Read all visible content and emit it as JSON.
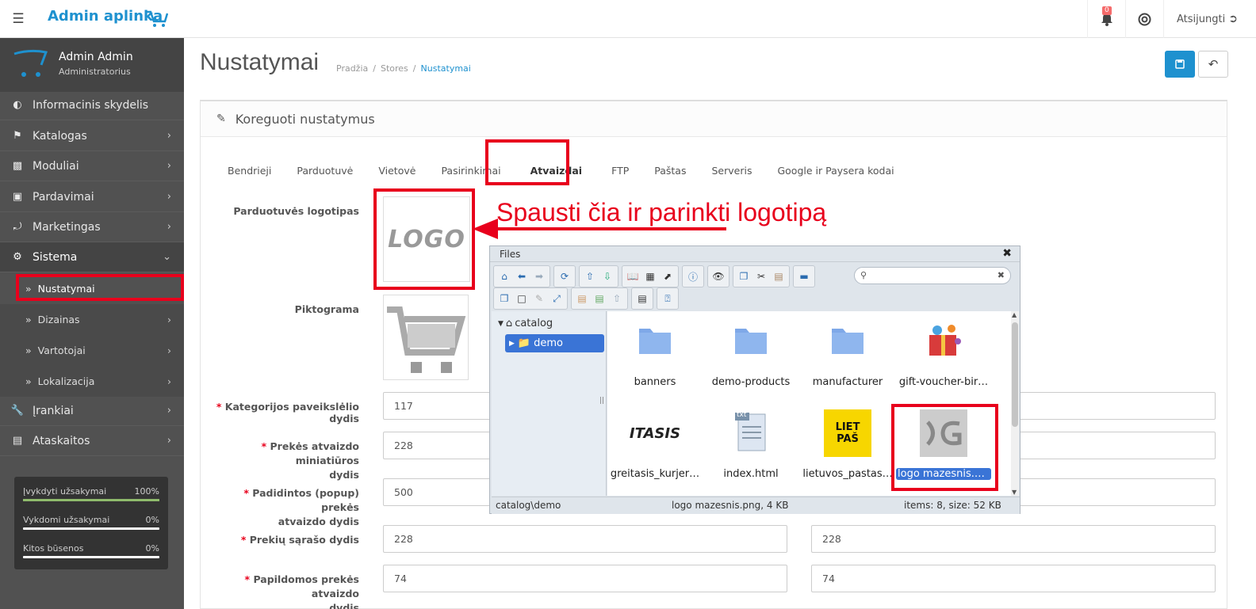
{
  "topbar": {
    "brand": "Admin aplinka",
    "notif_count": "0",
    "logout": "Atsijungti"
  },
  "profile": {
    "name": "Admin Admin",
    "role": "Administratorius"
  },
  "nav": {
    "dashboard": "Informacinis skydelis",
    "catalog": "Katalogas",
    "modules": "Moduliai",
    "sales": "Pardavimai",
    "marketing": "Marketingas",
    "system": "Sistema",
    "settings": "Nustatymai",
    "design": "Dizainas",
    "users": "Vartotojai",
    "localisation": "Lokalizacija",
    "tools": "Įrankiai",
    "reports": "Ataskaitos"
  },
  "stats": [
    {
      "label": "Įvykdyti užsakymai",
      "value": "100%",
      "fraction": 1.0
    },
    {
      "label": "Vykdomi užsakymai",
      "value": "0%",
      "fraction": 0.0
    },
    {
      "label": "Kitos būsenos",
      "value": "0%",
      "fraction": 0.0
    }
  ],
  "page": {
    "title": "Nustatymai",
    "breadcrumb": [
      "Pradžia",
      "Stores",
      "Nustatymai"
    ]
  },
  "panel": {
    "title": "Koreguoti nustatymus"
  },
  "tabs": [
    "Bendrieji",
    "Parduotuvė",
    "Vietovė",
    "Pasirinkimai",
    "Atvaizdai",
    "FTP",
    "Paštas",
    "Serveris",
    "Google ir Paysera kodai"
  ],
  "form": {
    "logo_label": "Parduotuvės logotipas",
    "logo_text": "LOGO",
    "icon_label": "Piktograma",
    "req": "*",
    "fields": [
      {
        "label1": "Kategorijos paveikslėlio dydis",
        "label2": "",
        "w": "117",
        "h": ""
      },
      {
        "label1": "Prekės atvaizdo miniatiūros",
        "label2": "dydis",
        "w": "228",
        "h": ""
      },
      {
        "label1": "Padidintos (popup) prekės",
        "label2": "atvaizdo dydis",
        "w": "500",
        "h": ""
      },
      {
        "label1": "Prekių sąrašo dydis",
        "label2": "",
        "w": "228",
        "h": "228"
      },
      {
        "label1": "Papildomos prekės atvaizdo",
        "label2": "dydis",
        "w": "74",
        "h": "74"
      }
    ]
  },
  "annotation": "Spausti čia ir parinkti logotipą",
  "filemanager": {
    "title": "Files",
    "tree_root": "catalog",
    "tree_selected": "demo",
    "files": [
      "banners",
      "demo-products",
      "manufacturer",
      "gift-voucher-bir…",
      "greitasis_kurjer…",
      "index.html",
      "lietuvos_pastas…",
      "logo mazesnis.p…"
    ],
    "itasis_text": "ITASIS",
    "txt_badge": "txt",
    "liet_text": "LIET\nPAŠ",
    "status_path": "catalog\\demo",
    "status_file": "logo mazesnis.png, 4 KB",
    "status_items": "items: 8, size: 52 KB"
  },
  "colors": {
    "accent": "#1e91cf",
    "sidebar": "#515151",
    "highlight": "#e8001c"
  }
}
